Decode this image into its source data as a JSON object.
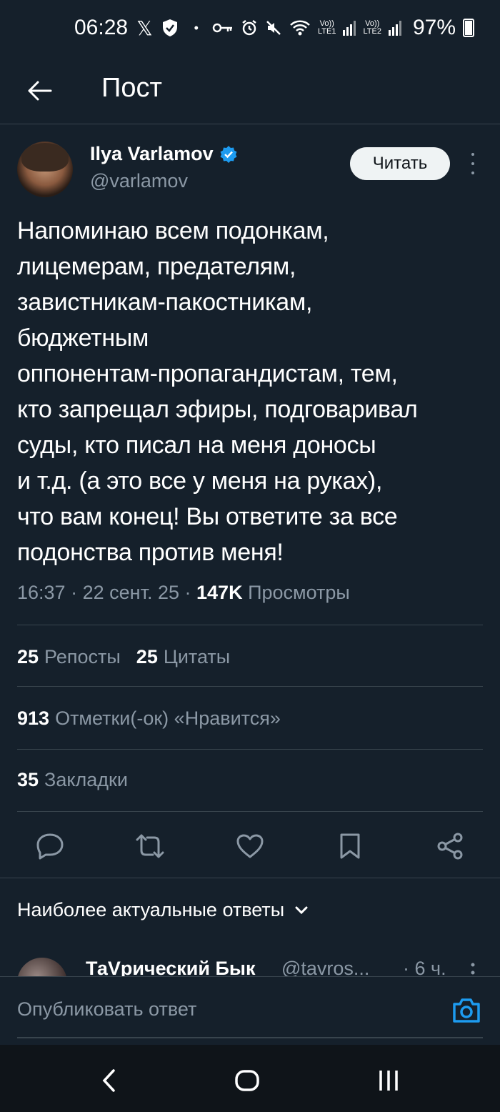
{
  "status_bar": {
    "time": "06:28",
    "x_glyph": "𝕏",
    "dot": "•",
    "lte1": "LTE1",
    "lte2": "LTE2",
    "volte1": "Vo))",
    "volte2": "Vo))",
    "battery": "97%",
    "icons": [
      "x-logo-icon",
      "shield-icon",
      "key-icon",
      "alarm-icon",
      "mute-icon",
      "wifi-icon",
      "signal-icon",
      "battery-icon"
    ]
  },
  "header": {
    "back_icon": "arrow-left-icon",
    "title": "Пост"
  },
  "post": {
    "author_name": "Ilya Varlamov",
    "author_handle": "@varlamov",
    "follow_label": "Читать",
    "text": "Напоминаю всем подонкам,\nлицемерам, предателям,\nзавистникам-пакостникам,\nбюджетным\nоппонентам-пропагандистам, тем,\nкто запрещал эфиры, подговаривал\nсуды, кто писал на меня доносы\nи т.д. (а это все у меня на руках),\nчто вам конец! Вы ответите за все\nподонства против меня!",
    "time": "16:37",
    "date": "22 сент. 25",
    "sep": "·",
    "views_count": "147K",
    "views_label": "Просмотры"
  },
  "stats": {
    "reposts_count": "25",
    "reposts_label": "Репосты",
    "quotes_count": "25",
    "quotes_label": "Цитаты",
    "likes_count": "913",
    "likes_label": "Отметки(-ок) «Нравится»",
    "bookmarks_count": "35",
    "bookmarks_label": "Закладки"
  },
  "actions": [
    "reply-icon",
    "retweet-icon",
    "like-icon",
    "bookmark-icon",
    "share-icon"
  ],
  "replies": {
    "header": "Наиболее актуальные ответы",
    "first_reply": {
      "name": "ТаVрический Бык",
      "handle": "@tavros...",
      "time": "· 6 ч."
    }
  },
  "compose": {
    "placeholder": "Опубликовать ответ"
  },
  "colors": {
    "background": "#15202b",
    "border": "#38444d",
    "muted": "#8b98a5",
    "accent": "#1d9bf0"
  }
}
